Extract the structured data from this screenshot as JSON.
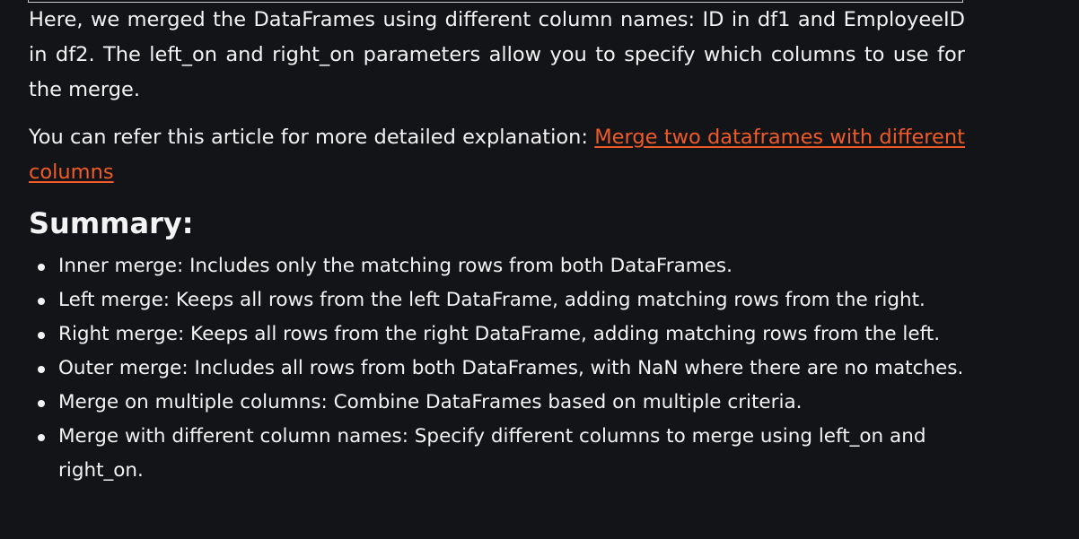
{
  "paragraphs": {
    "merge_explanation": "Here, we merged the DataFrames using different column names: ID in df1 and EmployeeID in df2. The left_on and right_on parameters allow you to specify which columns to use for the merge.",
    "refer_prefix": "You can refer this article for more detailed explanation: ",
    "refer_link": "Merge two dataframes with different columns"
  },
  "summary": {
    "heading": "Summary:",
    "items": [
      "Inner merge: Includes only the matching rows from both DataFrames.",
      "Left merge: Keeps all rows from the left DataFrame, adding matching rows from the right.",
      "Right merge: Keeps all rows from the right DataFrame, adding matching rows from the left.",
      "Outer merge: Includes all rows from both DataFrames, with NaN where there are no matches.",
      "Merge on multiple columns: Combine DataFrames based on multiple criteria.",
      "Merge with different column names: Specify different columns to merge using left_on and right_on."
    ]
  },
  "colors": {
    "background": "#131417",
    "text": "#f3f3f3",
    "link": "#f05a28"
  }
}
